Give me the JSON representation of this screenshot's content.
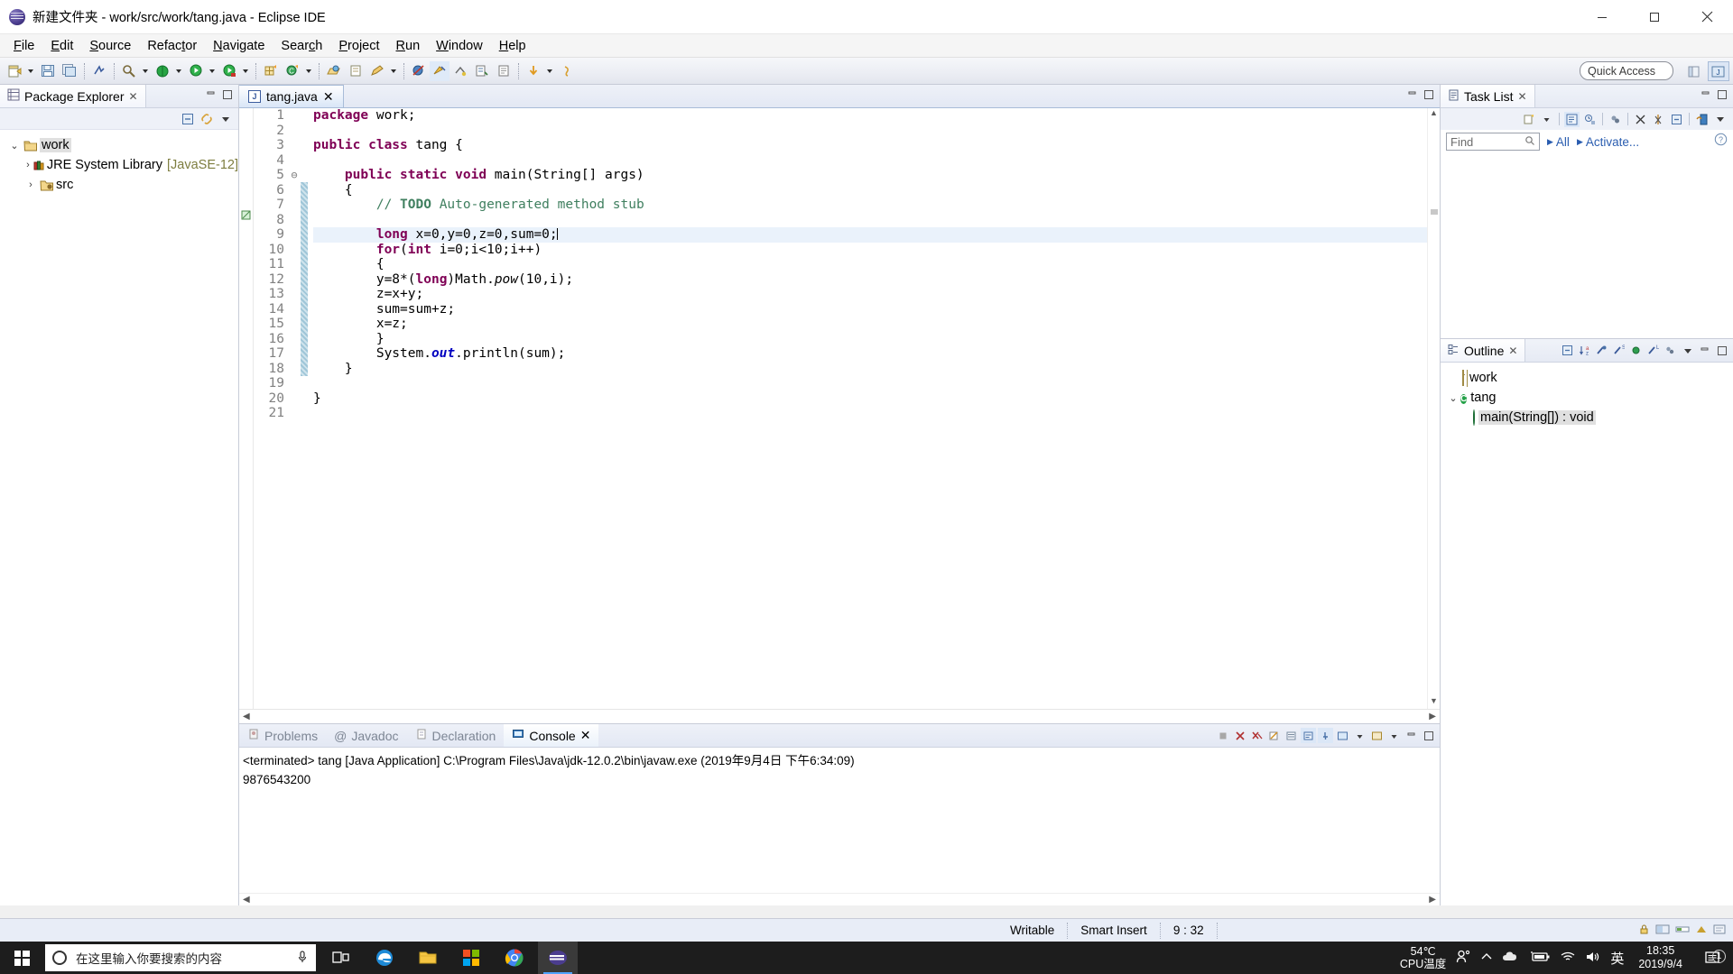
{
  "window": {
    "title": "新建文件夹 - work/src/work/tang.java - Eclipse IDE",
    "minimize_label": "Minimize",
    "maximize_label": "Restore",
    "close_label": "Close"
  },
  "menu": [
    {
      "label": "File",
      "mnemonic": "F"
    },
    {
      "label": "Edit",
      "mnemonic": "E"
    },
    {
      "label": "Source",
      "mnemonic": "S"
    },
    {
      "label": "Refactor",
      "mnemonic": "t"
    },
    {
      "label": "Navigate",
      "mnemonic": "N"
    },
    {
      "label": "Search",
      "mnemonic": "c"
    },
    {
      "label": "Project",
      "mnemonic": "P"
    },
    {
      "label": "Run",
      "mnemonic": "R"
    },
    {
      "label": "Window",
      "mnemonic": "W"
    },
    {
      "label": "Help",
      "mnemonic": "H"
    }
  ],
  "toolbar": {
    "quick_access": "Quick Access",
    "items": [
      "new-wizard-icon",
      "new-dropdown",
      "save-icon",
      "save-all-icon",
      "sep",
      "new-java-project-icon",
      "sep",
      "external-tools-icon",
      "external-tools-dropdown",
      "debug-icon",
      "debug-dropdown",
      "run-icon",
      "run-dropdown",
      "run-coverage-icon",
      "run-coverage-dropdown",
      "sep",
      "new-java-package-icon",
      "new-class-icon",
      "new-class-dropdown",
      "sep",
      "open-type-icon",
      "search-icon",
      "pencil-icon",
      "pencil-dropdown",
      "sep",
      "skip-breakpoints-icon",
      "terminate-icon",
      "next-annotation-icon",
      "previous-annotation-icon",
      "last-edit-location-icon",
      "back-icon",
      "back-dropdown",
      "forward-icon"
    ],
    "perspectives": [
      "java-perspective-icon",
      "open-perspective-icon"
    ]
  },
  "package_explorer": {
    "tab_label": "Package Explorer",
    "tools": [
      "collapse-all-icon",
      "link-with-editor-icon",
      "view-menu-icon"
    ],
    "tree": [
      {
        "label": "work",
        "indent": 0,
        "expanded": true,
        "icon": "project-icon",
        "selected": true,
        "suffix": ""
      },
      {
        "label": "JRE System Library",
        "indent": 1,
        "expanded": false,
        "icon": "library-icon",
        "selected": false,
        "suffix": "[JavaSE-12]"
      },
      {
        "label": "src",
        "indent": 1,
        "expanded": false,
        "icon": "source-folder-icon",
        "selected": false,
        "suffix": ""
      }
    ]
  },
  "editor": {
    "tab_label": "tang.java",
    "gutter_from": 1,
    "gutter_to": 21,
    "cursor_line": 9,
    "lines": [
      {
        "n": 1,
        "html": "<span class=\"kw\">package</span> work;"
      },
      {
        "n": 2,
        "html": ""
      },
      {
        "n": 3,
        "html": "<span class=\"kw\">public class</span> tang {"
      },
      {
        "n": 4,
        "html": ""
      },
      {
        "n": 5,
        "html": "    <span class=\"kw\">public static void</span> main(String[] args)",
        "fold": true
      },
      {
        "n": 6,
        "html": "    {"
      },
      {
        "n": 7,
        "html": "        <span class=\"cm\">// <span class=\"todo\">TODO</span> Auto-generated method stub</span>"
      },
      {
        "n": 8,
        "html": ""
      },
      {
        "n": 9,
        "html": "        <span class=\"kw\">long</span> x=0,y=0,z=0,sum=0;",
        "current": true
      },
      {
        "n": 10,
        "html": "        <span class=\"kw\">for</span>(<span class=\"kw\">int</span> i=0;i&lt;10;i++)"
      },
      {
        "n": 11,
        "html": "        {"
      },
      {
        "n": 12,
        "html": "        y=8*(<span class=\"kw\">long</span>)Math.<span class=\"st\">pow</span>(10,i);"
      },
      {
        "n": 13,
        "html": "        z=x+y;"
      },
      {
        "n": 14,
        "html": "        sum=sum+z;"
      },
      {
        "n": 15,
        "html": "        x=z;"
      },
      {
        "n": 16,
        "html": "        }"
      },
      {
        "n": 17,
        "html": "        System.<span class=\"stf\">out</span>.println(sum);"
      },
      {
        "n": 18,
        "html": "    }"
      },
      {
        "n": 19,
        "html": ""
      },
      {
        "n": 20,
        "html": "}"
      },
      {
        "n": 21,
        "html": ""
      }
    ]
  },
  "bottom_panel": {
    "tabs": [
      {
        "label": "Problems",
        "icon": "problems-icon",
        "active": false
      },
      {
        "label": "Javadoc",
        "icon": "javadoc-icon",
        "active": false
      },
      {
        "label": "Declaration",
        "icon": "declaration-icon",
        "active": false
      },
      {
        "label": "Console",
        "icon": "console-icon",
        "active": true
      }
    ],
    "console": {
      "header": "<terminated> tang [Java Application] C:\\Program Files\\Java\\jdk-12.0.2\\bin\\javaw.exe (2019年9月4日 下午6:34:09)",
      "output": "9876543200"
    },
    "tools": [
      "terminate-icon",
      "remove-launch-icon",
      "remove-all-launches-icon",
      "clear-console-icon",
      "scroll-lock-icon",
      "word-wrap-icon",
      "pin-console-icon",
      "display-console-icon",
      "display-console-dropdown",
      "open-console-icon",
      "open-console-dropdown",
      "view-menu-icon"
    ]
  },
  "task_list": {
    "tab_label": "Task List",
    "find_placeholder": "Find",
    "filter_all": "All",
    "activate_link": "Activate...",
    "tools": [
      "new-task-icon",
      "new-task-dropdown",
      "categorized-icon",
      "scheduled-icon",
      "synchronize-icon",
      "focus-on-workweek-icon",
      "filter-completed-icon",
      "collapse-all-icon",
      "restore-tasks-icon",
      "view-menu-icon"
    ],
    "help_icon": "help-icon"
  },
  "outline": {
    "tab_label": "Outline",
    "tools": [
      "collapse-all-icon",
      "sort-icon",
      "hide-fields-icon",
      "hide-static-icon",
      "hide-nonpublic-icon",
      "hide-local-types-icon",
      "link-with-editor-icon",
      "view-menu-icon"
    ],
    "items": [
      {
        "label": "work",
        "icon": "package-icon",
        "indent": 1,
        "expanded": null,
        "selected": false
      },
      {
        "label": "tang",
        "icon": "class-icon",
        "indent": 0,
        "expanded": true,
        "selected": false
      },
      {
        "label": "main(String[]) : void",
        "icon": "method-static-icon",
        "indent": 2,
        "expanded": null,
        "selected": true
      }
    ]
  },
  "status_bar": {
    "writable": "Writable",
    "insert_mode": "Smart Insert",
    "position": "9 : 32"
  },
  "taskbar": {
    "search_placeholder": "在这里输入你要搜索的内容",
    "apps": [
      {
        "name": "task-view-icon"
      },
      {
        "name": "edge-icon"
      },
      {
        "name": "file-explorer-icon"
      },
      {
        "name": "microsoft-store-icon"
      },
      {
        "name": "chrome-icon"
      },
      {
        "name": "eclipse-icon",
        "active": true
      }
    ],
    "cpu_temp_value": "54℃",
    "cpu_temp_label": "CPU温度",
    "input_method": "英",
    "time": "18:35",
    "date": "2019/9/4",
    "notification_count": "1"
  },
  "colors": {
    "keyword": "#7f0055",
    "comment": "#3f7f5f",
    "static_field": "#0000c0",
    "current_line": "#eaf2fb",
    "chrome": "#e3e8f4",
    "link": "#2a5db0"
  }
}
